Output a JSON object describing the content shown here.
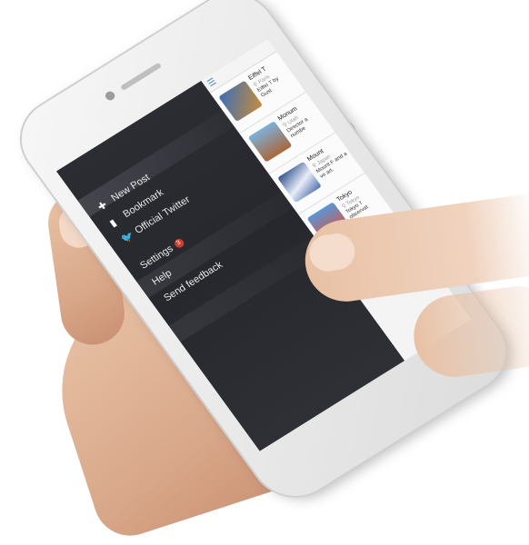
{
  "drawer": {
    "items": [
      {
        "label": "New Post",
        "icon": "plus-icon"
      },
      {
        "label": "Bookmark",
        "icon": "bookmark-icon"
      },
      {
        "label": "Official Twitter",
        "icon": "twitter-icon"
      }
    ],
    "secondary": [
      {
        "label": "Settings",
        "badge": "3"
      },
      {
        "label": "Help"
      },
      {
        "label": "Send feedback"
      }
    ]
  },
  "posts": [
    {
      "title": "Eiffel T",
      "location": "Paris",
      "desc": "Eiffel T by Gust",
      "color": "#c98b3d"
    },
    {
      "title": "Monum",
      "location": "Utah",
      "desc": "Director a numbe",
      "color": "#a9673b"
    },
    {
      "title": "Mount",
      "location": "Japan",
      "desc": "Mount F and a vo art.",
      "color": "#4f6fb0"
    },
    {
      "title": "Tokyo",
      "location": "Tokyo",
      "desc": "Tokyo T observat",
      "color": "#d8563a"
    }
  ],
  "colors": {
    "drawer_bg": "#2b2d33",
    "accent": "#4a88c7",
    "badge": "#d23a2a"
  }
}
